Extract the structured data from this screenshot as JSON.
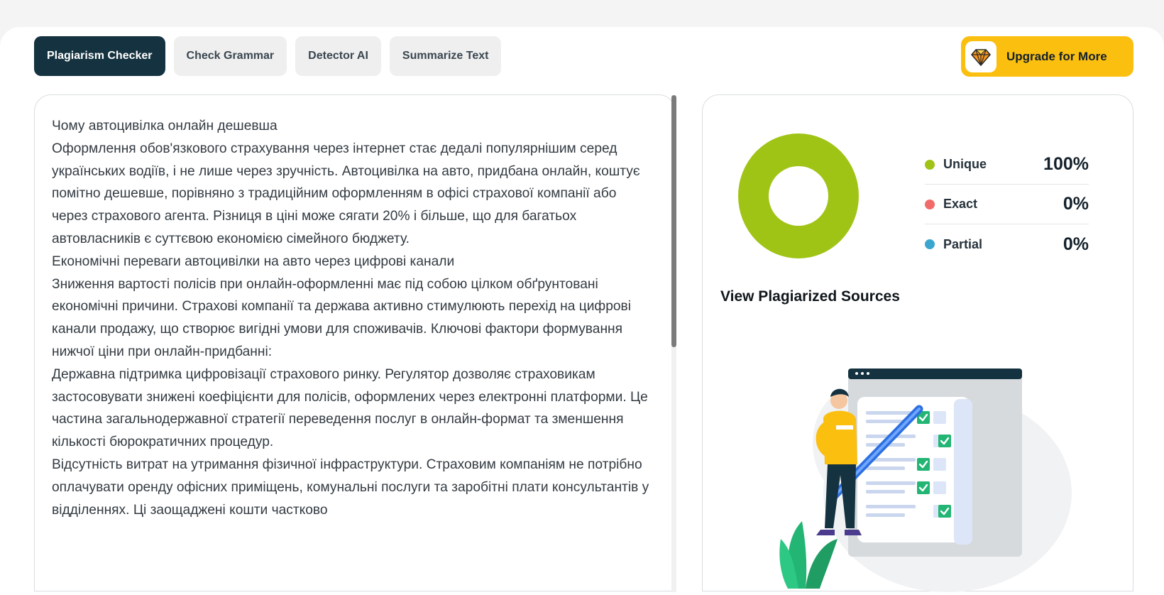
{
  "tabs": [
    {
      "label": "Plagiarism Checker",
      "active": true
    },
    {
      "label": "Check Grammar",
      "active": false
    },
    {
      "label": "Detector AI",
      "active": false
    },
    {
      "label": "Summarize Text",
      "active": false
    }
  ],
  "upgrade": {
    "label": "Upgrade for More",
    "icon": "diamond-icon"
  },
  "editor": {
    "paragraphs": [
      "Чому автоцивілка онлайн дешевша",
      "Оформлення обов'язкового страхування через інтернет стає дедалі популярнішим серед українських водіїв, і не лише через зручність. Автоцивілка на авто, придбана онлайн, коштує помітно дешевше, порівняно з традиційним оформленням в офісі страхової компанії або через страхового агента. Різниця в ціні може сягати 20% і більше, що для багатьох автовласників є суттєвою економією сімейного бюджету.",
      "Економічні переваги автоцивілки на авто через цифрові канали",
      "Зниження вартості полісів при онлайн-оформленні має під собою цілком обґрунтовані економічні причини. Страхові компанії та держава активно стимулюють перехід на цифрові канали продажу, що створює вигідні умови для споживачів. Ключові фактори формування нижчої ціни при онлайн-придбанні:",
      "Державна підтримка цифровізації страхового ринку. Регулятор дозволяє страховикам застосовувати знижені коефіцієнти для полісів, оформлених через електронні платформи. Це частина загальнодержавної стратегії переведення послуг в онлайн-формат та зменшення кількості бюрократичних процедур.",
      "Відсутність витрат на утримання фізичної інфраструктури. Страховим компаніям не потрібно оплачувати оренду офісних приміщень, комунальні послуги та заробітні плати консультантів у відділеннях. Ці заощаджені кошти частково"
    ]
  },
  "results": {
    "legend": [
      {
        "name": "Unique",
        "value": "100%",
        "percent": 100,
        "color": "#9fc415"
      },
      {
        "name": "Exact",
        "value": "0%",
        "percent": 0,
        "color": "#f26b6b"
      },
      {
        "name": "Partial",
        "value": "0%",
        "percent": 0,
        "color": "#3aa6d0"
      }
    ],
    "sources_title": "View Plagiarized Sources"
  }
}
